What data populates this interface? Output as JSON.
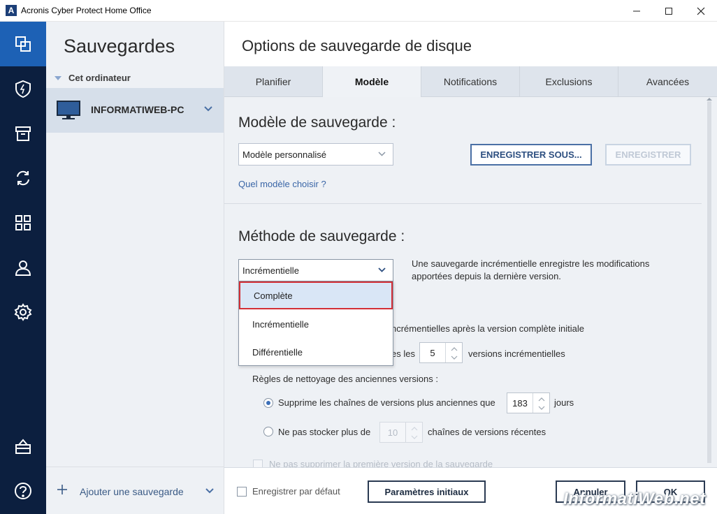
{
  "window": {
    "title": "Acronis Cyber Protect Home Office",
    "logo_letter": "A"
  },
  "nav": {
    "items": [
      {
        "icon": "backup-copy-icon",
        "active": true
      },
      {
        "icon": "shield-icon"
      },
      {
        "icon": "archive-icon"
      },
      {
        "icon": "sync-icon"
      },
      {
        "icon": "tools-grid-icon"
      },
      {
        "icon": "account-icon"
      },
      {
        "icon": "settings-gear-icon"
      },
      {
        "icon": "shop-bag-icon"
      },
      {
        "icon": "help-icon"
      }
    ]
  },
  "sidebar": {
    "title": "Sauvegardes",
    "group_label": "Cet ordinateur",
    "computer_name": "INFORMATIWEB-PC",
    "add_backup_label": "Ajouter une sauvegarde"
  },
  "main": {
    "title": "Options de sauvegarde de disque",
    "tabs": [
      {
        "label": "Planifier"
      },
      {
        "label": "Modèle",
        "active": true
      },
      {
        "label": "Notifications"
      },
      {
        "label": "Exclusions"
      },
      {
        "label": "Avancées"
      }
    ]
  },
  "scheme": {
    "section_title": "Modèle de sauvegarde :",
    "selected": "Modèle personnalisé",
    "save_as_label": "ENREGISTRER SOUS...",
    "save_label": "ENREGISTRER",
    "help_link": "Quel modèle choisir ?"
  },
  "method": {
    "section_title": "Méthode de sauvegarde :",
    "selected": "Incrémentielle",
    "description": "Une sauvegarde incrémentielle enregistre les modifications apportées depuis la dernière version.",
    "options": [
      "Complète",
      "Incrémentielle",
      "Différentielle"
    ],
    "highlighted_option": "Complète",
    "chain_text": "ncrémentielles après la version complète initiale",
    "every_text_prefix": "es les",
    "every_value": "5",
    "every_text_suffix": "versions incrémentielles"
  },
  "cleanup": {
    "title": "Règles de nettoyage des anciennes versions :",
    "option1_label": "Supprime les chaînes de versions plus anciennes que",
    "option1_value": "183",
    "option1_unit": "jours",
    "option2_label": "Ne pas stocker plus de",
    "option2_value": "10",
    "option2_unit": "chaînes de versions récentes",
    "keep_first_label": "Ne pas supprimer la première version de la sauvegarde"
  },
  "footer": {
    "save_default_label": "Enregistrer par défaut",
    "initial_settings_label": "Paramètres initiaux",
    "cancel_label": "Annuler",
    "ok_label": "OK"
  },
  "watermark": "InformatiWeb.net"
}
